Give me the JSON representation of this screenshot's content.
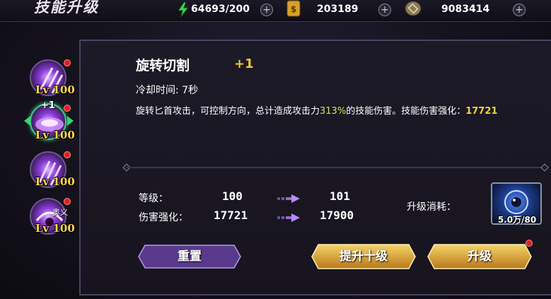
{
  "header": {
    "title": "技能升级"
  },
  "resources": [
    {
      "icon": "stamina-icon",
      "value": "64693/200"
    },
    {
      "icon": "gold-ticket-icon",
      "value": "203189"
    },
    {
      "icon": "coin-icon",
      "value": "9083414"
    }
  ],
  "skills": [
    {
      "level": "Lv 100",
      "badge": ""
    },
    {
      "level": "Lv 100",
      "badge": "+1"
    },
    {
      "level": "Lv 100",
      "badge": ""
    },
    {
      "level": "Lv 100",
      "badge": "奥义"
    }
  ],
  "detail": {
    "name": "旋转切割",
    "plus": "+1",
    "cooldown": "冷却时间: 7秒",
    "desc_part1": "旋转匕首攻击，可控制方向，总计造成攻击力",
    "desc_highlight": "313%",
    "desc_part2": "的技能伤害。技能伤害强化：",
    "desc_value": "17721"
  },
  "stats": {
    "level_label": "等级：",
    "level_current": "100",
    "level_next": "101",
    "damage_label": "伤害强化：",
    "damage_current": "17721",
    "damage_next": "17900"
  },
  "cost": {
    "label": "升级消耗：",
    "count": "5.0万/80"
  },
  "buttons": {
    "reset": "重置",
    "upgrade_ten": "提升十级",
    "upgrade": "升级"
  },
  "colors": {
    "gold": "#f0c93a",
    "purple_button": "#5a3a8c",
    "highlight": "#c8e85a",
    "red_dot": "#e41e1e"
  }
}
